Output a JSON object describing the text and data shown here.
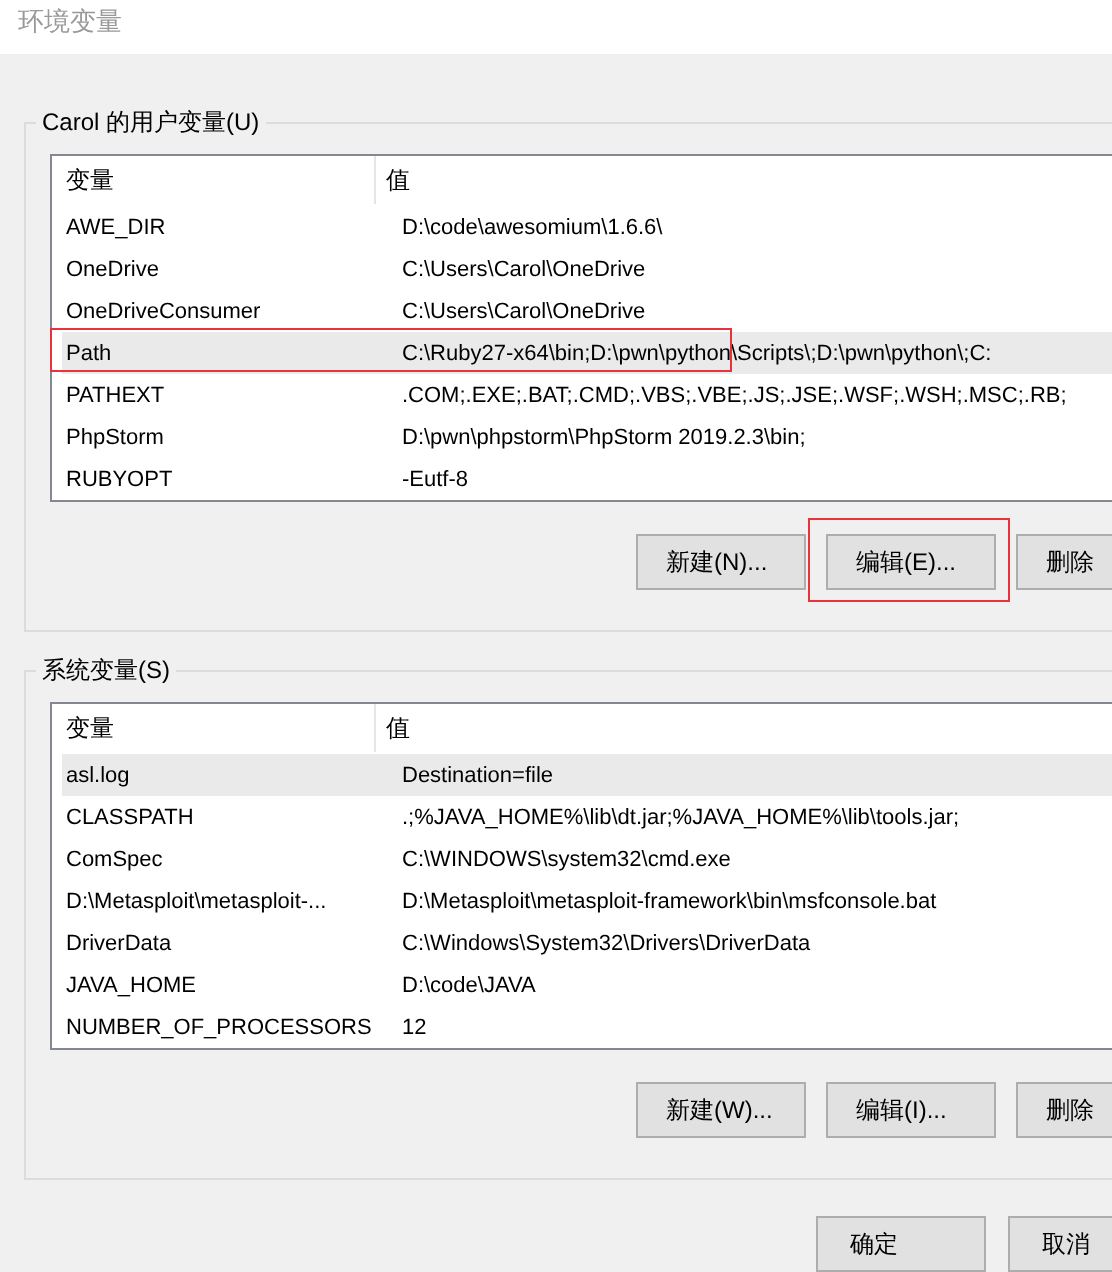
{
  "window": {
    "title": "环境变量"
  },
  "groups": [
    {
      "title": "Carol 的用户变量(U)",
      "columns": [
        "变量",
        "值"
      ],
      "rows": [
        {
          "name": "AWE_DIR",
          "value": "D:\\code\\awesomium\\1.6.6\\",
          "selected": false,
          "highlighted": false
        },
        {
          "name": "OneDrive",
          "value": "C:\\Users\\Carol\\OneDrive",
          "selected": false,
          "highlighted": false
        },
        {
          "name": "OneDriveConsumer",
          "value": "C:\\Users\\Carol\\OneDrive",
          "selected": false,
          "highlighted": false
        },
        {
          "name": "Path",
          "value": "C:\\Ruby27-x64\\bin;D:\\pwn\\python\\Scripts\\;D:\\pwn\\python\\;C:",
          "selected": true,
          "highlighted": true
        },
        {
          "name": "PATHEXT",
          "value": ".COM;.EXE;.BAT;.CMD;.VBS;.VBE;.JS;.JSE;.WSF;.WSH;.MSC;.RB;",
          "selected": false,
          "highlighted": false
        },
        {
          "name": "PhpStorm",
          "value": "D:\\pwn\\phpstorm\\PhpStorm 2019.2.3\\bin;",
          "selected": false,
          "highlighted": false
        },
        {
          "name": "RUBYOPT",
          "value": "-Eutf-8",
          "selected": false,
          "highlighted": false
        }
      ],
      "buttons": [
        {
          "label": "新建(N)...",
          "highlighted": false
        },
        {
          "label": "编辑(E)...",
          "highlighted": true
        },
        {
          "label": "删除",
          "highlighted": false
        }
      ]
    },
    {
      "title": "系统变量(S)",
      "columns": [
        "变量",
        "值"
      ],
      "rows": [
        {
          "name": "asl.log",
          "value": "Destination=file",
          "selected": true,
          "highlighted": false
        },
        {
          "name": "CLASSPATH",
          "value": ".;%JAVA_HOME%\\lib\\dt.jar;%JAVA_HOME%\\lib\\tools.jar;",
          "selected": false,
          "highlighted": false
        },
        {
          "name": "ComSpec",
          "value": "C:\\WINDOWS\\system32\\cmd.exe",
          "selected": false,
          "highlighted": false
        },
        {
          "name": "D:\\Metasploit\\metasploit-...",
          "value": "D:\\Metasploit\\metasploit-framework\\bin\\msfconsole.bat",
          "selected": false,
          "highlighted": false
        },
        {
          "name": "DriverData",
          "value": "C:\\Windows\\System32\\Drivers\\DriverData",
          "selected": false,
          "highlighted": false
        },
        {
          "name": "JAVA_HOME",
          "value": "D:\\code\\JAVA",
          "selected": false,
          "highlighted": false
        },
        {
          "name": "NUMBER_OF_PROCESSORS",
          "value": "12",
          "selected": false,
          "highlighted": false
        }
      ],
      "buttons": [
        {
          "label": "新建(W)...",
          "highlighted": false
        },
        {
          "label": "编辑(I)...",
          "highlighted": false
        },
        {
          "label": "删除",
          "highlighted": false
        }
      ]
    }
  ],
  "footer_buttons": [
    "确定",
    "取消"
  ]
}
